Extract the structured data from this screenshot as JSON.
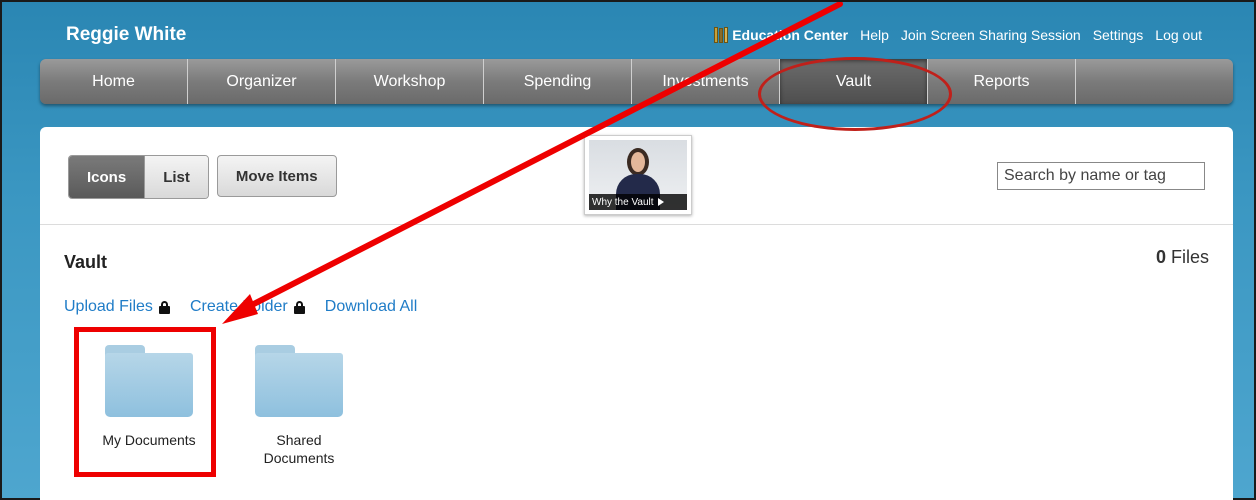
{
  "header": {
    "user_name": "Reggie White",
    "links": {
      "education_center": "Education Center",
      "help": "Help",
      "screen_share": "Join Screen Sharing Session",
      "settings": "Settings",
      "logout": "Log out"
    }
  },
  "nav": {
    "tabs": [
      "Home",
      "Organizer",
      "Workshop",
      "Spending",
      "Investments",
      "Vault",
      "Reports"
    ],
    "active": "Vault"
  },
  "toolbar": {
    "icons_label": "Icons",
    "list_label": "List",
    "move_label": "Move Items"
  },
  "video": {
    "caption": "Why the Vault"
  },
  "search": {
    "placeholder": "Search by name or tag"
  },
  "vault": {
    "title": "Vault",
    "files_count": "0",
    "files_label": "Files",
    "actions": {
      "upload": "Upload Files",
      "create_folder": "Create Folder",
      "download_all": "Download All"
    },
    "folders": [
      {
        "name": "My Documents"
      },
      {
        "name": "Shared Documents"
      }
    ]
  },
  "colors": {
    "background": "#3b97c2",
    "link": "#1f7cc7",
    "annotation": "#e00000"
  }
}
